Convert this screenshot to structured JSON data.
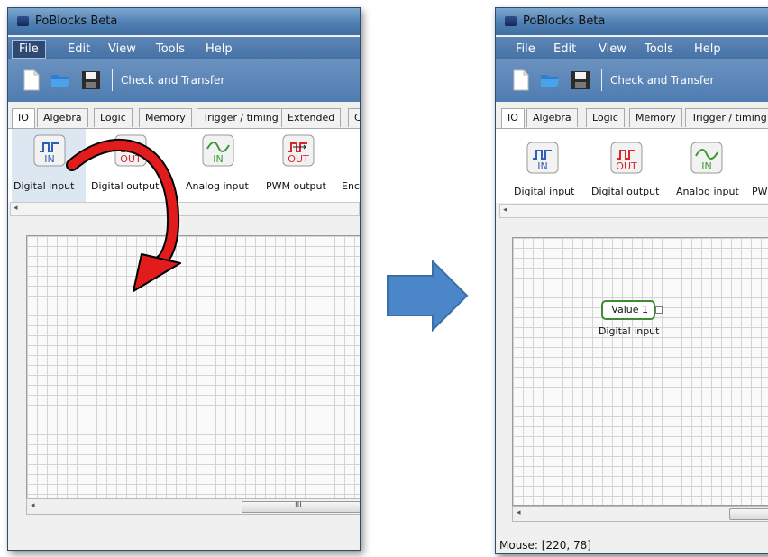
{
  "left_window": {
    "title": "PoBlocks Beta",
    "menu": [
      "File",
      "Edit",
      "View",
      "Tools",
      "Help"
    ],
    "toolbar": {
      "check_transfer": "Check and Transfer"
    },
    "tabs": [
      "IO",
      "Algebra",
      "Logic",
      "Memory",
      "Trigger / timing",
      "Extended",
      "C"
    ],
    "palette": [
      {
        "icon_text": "IN",
        "label": "Digital input",
        "icon": "digital-input-icon"
      },
      {
        "icon_text": "OUT",
        "label": "Digital output",
        "icon": "digital-output-icon"
      },
      {
        "icon_text": "IN",
        "label": "Analog input",
        "icon": "analog-input-icon"
      },
      {
        "icon_text": "OUT",
        "label": "PWM output",
        "icon": "pwm-output-icon"
      },
      {
        "label": "Enc"
      }
    ],
    "scroll_thumb": "III"
  },
  "right_window": {
    "title": "PoBlocks Beta",
    "menu": [
      "File",
      "Edit",
      "View",
      "Tools",
      "Help"
    ],
    "toolbar": {
      "check_transfer": "Check and Transfer"
    },
    "tabs": [
      "IO",
      "Algebra",
      "Logic",
      "Memory",
      "Trigger / timing"
    ],
    "palette": [
      {
        "icon_text": "IN",
        "label": "Digital input",
        "icon": "digital-input-icon"
      },
      {
        "icon_text": "OUT",
        "label": "Digital output",
        "icon": "digital-output-icon"
      },
      {
        "icon_text": "IN",
        "label": "Analog input",
        "icon": "analog-input-icon"
      },
      {
        "label": "PW"
      }
    ],
    "block": {
      "value": "Value 1",
      "caption": "Digital input"
    },
    "status": "Mouse: [220, 78]"
  },
  "colors": {
    "titlebar": "#5f86b6",
    "digital_in": "#2f5fb3",
    "digital_out": "#d8262b",
    "analog_in": "#3c9a35",
    "arrow_red": "#e21c1c",
    "arrow_blue": "#4a86c8",
    "block_border": "#3d8c32"
  }
}
